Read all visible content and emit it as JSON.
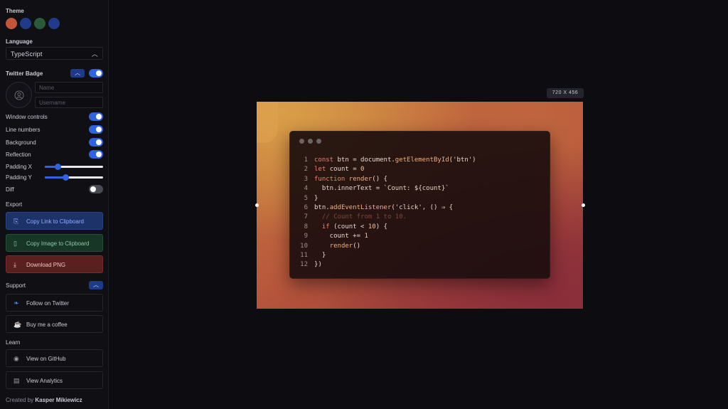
{
  "sidebar": {
    "theme_title": "Theme",
    "theme_swatches": [
      {
        "name": "orange",
        "color": "#c4553a"
      },
      {
        "name": "blue",
        "color": "#1f3a8a"
      },
      {
        "name": "green",
        "color": "#2a5a3a"
      },
      {
        "name": "indigo",
        "color": "#213a8c"
      }
    ],
    "language_title": "Language",
    "language_value": "TypeScript",
    "twitter_badge_title": "Twitter Badge",
    "name_placeholder": "Name",
    "username_placeholder": "Username",
    "toggles": [
      {
        "label": "Window controls",
        "on": true
      },
      {
        "label": "Line numbers",
        "on": true
      },
      {
        "label": "Background",
        "on": true
      },
      {
        "label": "Reflection",
        "on": true
      }
    ],
    "padding_x_label": "Padding X",
    "padding_y_label": "Padding Y",
    "padding_x_level": 0.22,
    "padding_y_level": 0.35,
    "diff_label": "Diff",
    "diff_on": false,
    "export_title": "Export",
    "copy_link_label": "Copy Link to Clipboard",
    "copy_image_label": "Copy Image to Clipboard",
    "download_png_label": "Download PNG",
    "support_title": "Support",
    "follow_twitter_label": "Follow on Twitter",
    "buy_coffee_label": "Buy me a coffee",
    "learn_title": "Learn",
    "github_label": "View on GitHub",
    "analytics_label": "View Analytics",
    "credit_prefix": "Created by",
    "credit_author": "Kasper Mikiewicz"
  },
  "canvas": {
    "size_badge": "720 X 456",
    "code_lines": [
      [
        [
          "kw",
          "const "
        ],
        [
          "plain",
          "btn = document."
        ],
        [
          "fn",
          "getElementById"
        ],
        [
          "plain",
          "("
        ],
        [
          "str",
          "'btn'"
        ],
        [
          "plain",
          ")"
        ]
      ],
      [
        [
          "kw",
          "let "
        ],
        [
          "plain",
          "count = "
        ],
        [
          "num",
          "0"
        ]
      ],
      [
        [
          "kw",
          "function "
        ],
        [
          "fn",
          "render"
        ],
        [
          "plain",
          "() {"
        ]
      ],
      [
        [
          "plain",
          "  btn.innerText = "
        ],
        [
          "str",
          "`Count: ${count}`"
        ]
      ],
      [
        [
          "plain",
          "}"
        ]
      ],
      [
        [
          "plain",
          "btn."
        ],
        [
          "fn",
          "addEventListener"
        ],
        [
          "plain",
          "("
        ],
        [
          "str",
          "'click'"
        ],
        [
          "plain",
          ", () ⇒ {"
        ]
      ],
      [
        [
          "cm",
          "  // Count from 1 to 10."
        ]
      ],
      [
        [
          "kw",
          "  if "
        ],
        [
          "plain",
          "(count < "
        ],
        [
          "num",
          "10"
        ],
        [
          "plain",
          ") {"
        ]
      ],
      [
        [
          "plain",
          "    count += "
        ],
        [
          "num",
          "1"
        ]
      ],
      [
        [
          "plain",
          "    "
        ],
        [
          "fn",
          "render"
        ],
        [
          "plain",
          "()"
        ]
      ],
      [
        [
          "plain",
          "  }"
        ]
      ],
      [
        [
          "plain",
          "})"
        ]
      ]
    ]
  }
}
